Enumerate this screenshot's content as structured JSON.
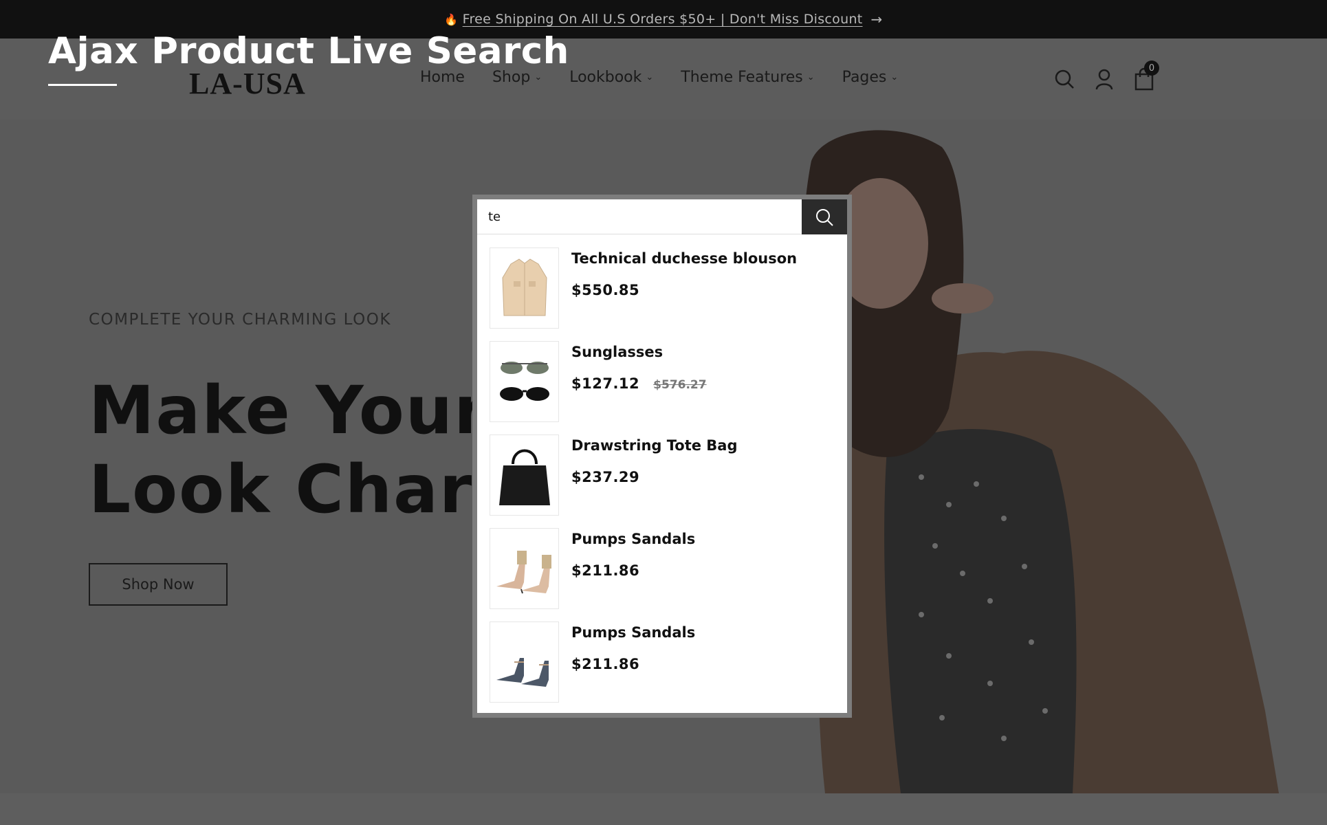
{
  "announcement": {
    "text": "Free Shipping On All U.S Orders $50+ | Don't Miss Discount",
    "icon": "flame-icon",
    "arrow_icon": "arrow-right-icon"
  },
  "overlay": {
    "title": "Ajax Product Live Search"
  },
  "header": {
    "logo": "LA-USA",
    "nav": [
      {
        "label": "Home"
      },
      {
        "label": "Shop"
      },
      {
        "label": "Lookbook"
      },
      {
        "label": "Theme Features"
      },
      {
        "label": "Pages"
      }
    ],
    "icons": [
      "search-icon",
      "user-icon",
      "cart-icon"
    ],
    "cart_count": "0"
  },
  "hero": {
    "eyebrow": "COMPLETE YOUR CHARMING LOOK",
    "headline_line1": "Make Your",
    "headline_line2": "Look Charm",
    "cta": "Shop Now"
  },
  "search": {
    "value": "te",
    "button_icon": "search-icon",
    "results": [
      {
        "name": "Technical duchesse blouson",
        "price": "$550.85",
        "old_price": "",
        "image": "jacket"
      },
      {
        "name": "Sunglasses",
        "price": "$127.12",
        "old_price": "$576.27",
        "image": "sunglasses"
      },
      {
        "name": "Drawstring Tote Bag",
        "price": "$237.29",
        "image": "bag"
      },
      {
        "name": "Pumps Sandals",
        "price": "$211.86",
        "image": "sandals-beige"
      },
      {
        "name": "Pumps Sandals",
        "price": "$211.86",
        "image": "sandals-blue"
      }
    ]
  },
  "colors": {
    "topbar": "#111111",
    "overlay": "#5a5a5a",
    "search_button": "#2b2b2b"
  }
}
